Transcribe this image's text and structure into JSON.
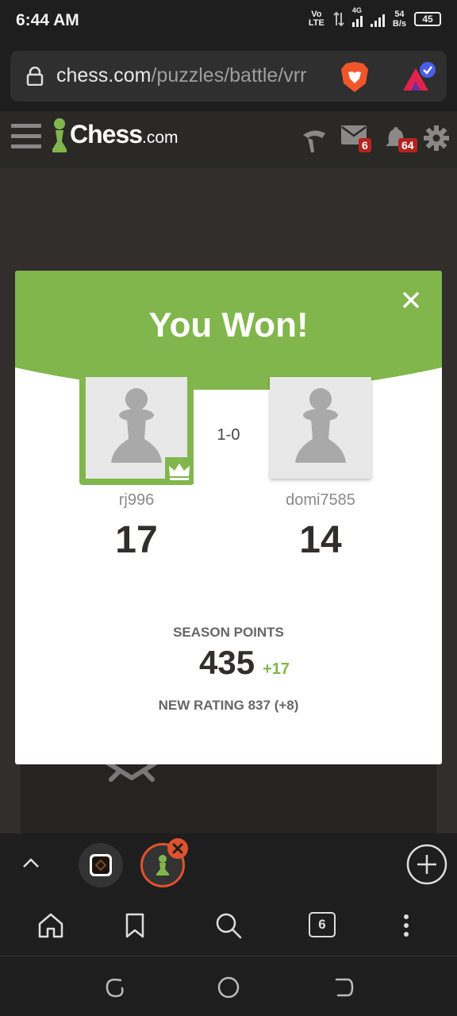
{
  "status_bar": {
    "time": "6:44 AM",
    "volte_line1": "Vo",
    "volte_line2": "LTE",
    "network": "4G",
    "speed_value": "54",
    "speed_unit": "B/s",
    "battery": "45"
  },
  "url_bar": {
    "host": "chess.com",
    "path": "/puzzles/battle/vrr"
  },
  "site_header": {
    "logo_text": "Chess",
    "logo_suffix": ".com",
    "messages_badge": "6",
    "notifications_badge": "64"
  },
  "modal": {
    "title": "You Won!",
    "result": "1-0",
    "player_left": {
      "name": "rj996",
      "score": "17"
    },
    "player_right": {
      "name": "domi7585",
      "score": "14"
    },
    "season_label": "SEASON POINTS",
    "season_points": "435",
    "season_delta": "+17",
    "new_rating": "NEW RATING 837 (+8)"
  },
  "toolbar": {
    "tab_count": "6"
  },
  "colors": {
    "accent_green": "#81b64c",
    "badge_red": "#b3231e",
    "tab_active_orange": "#e0522d"
  }
}
